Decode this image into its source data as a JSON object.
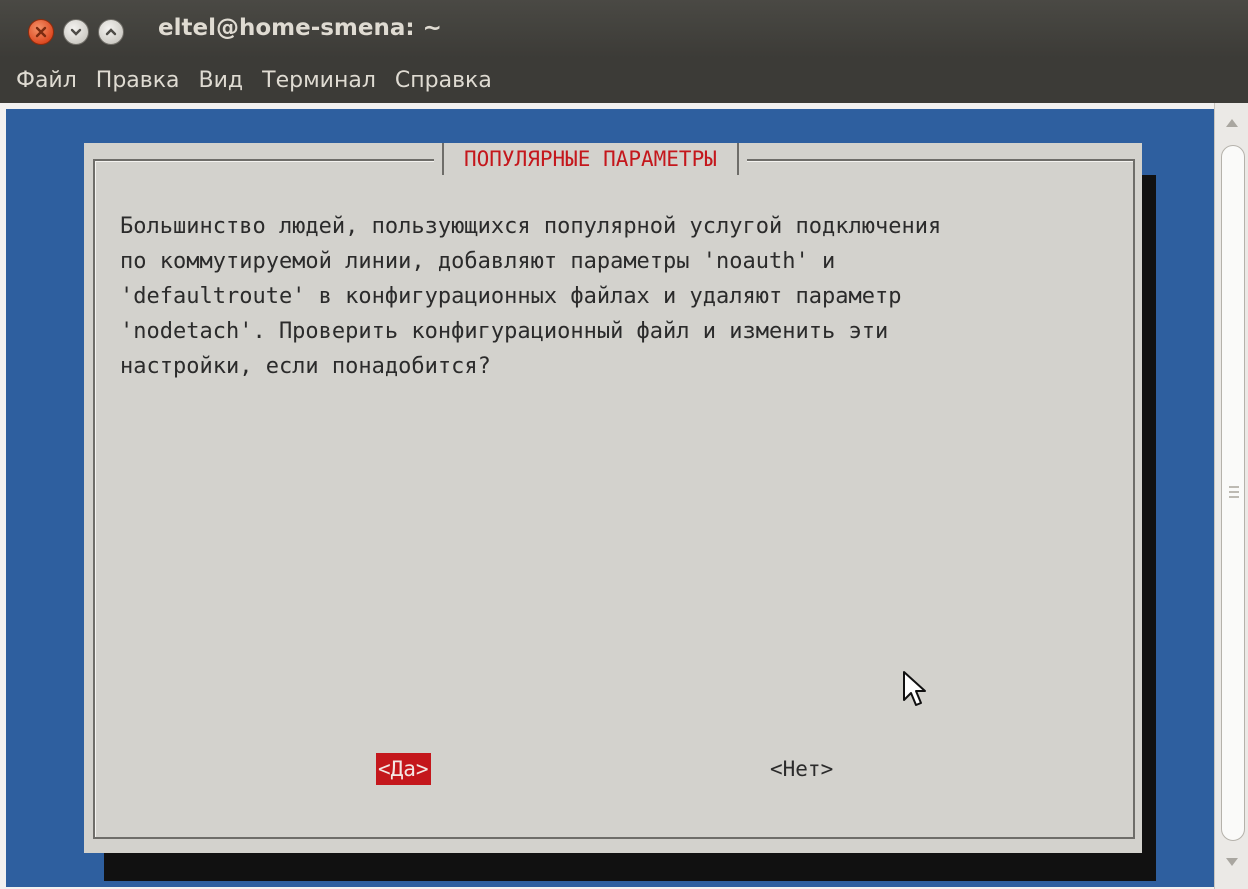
{
  "window": {
    "title": "eltel@home-smena: ~",
    "buttons": [
      "close-icon",
      "minimize-icon",
      "maximize-icon"
    ]
  },
  "menubar": {
    "items": [
      "Файл",
      "Правка",
      "Вид",
      "Терминал",
      "Справка"
    ]
  },
  "dialog": {
    "title": "ПОПУЛЯРНЫЕ ПАРАМЕТРЫ",
    "text_lines": [
      "Большинство людей, пользующихся популярной услугой подключения",
      "по коммутируемой линии, добавляют параметры 'noauth' и",
      "'defaultroute' в конфигурационных файлах и удаляют параметр",
      "'nodetach'. Проверить конфигурационный файл и изменить эти",
      "настройки, если понадобится?"
    ],
    "yes_label": "<Да>",
    "no_label": "<Нет>",
    "selected": "yes"
  },
  "colors": {
    "terminal_bg": "#2e5f9f",
    "dialog_bg": "#d3d2cd",
    "accent": "#c4171c",
    "titlebar": "#3c3b37"
  }
}
